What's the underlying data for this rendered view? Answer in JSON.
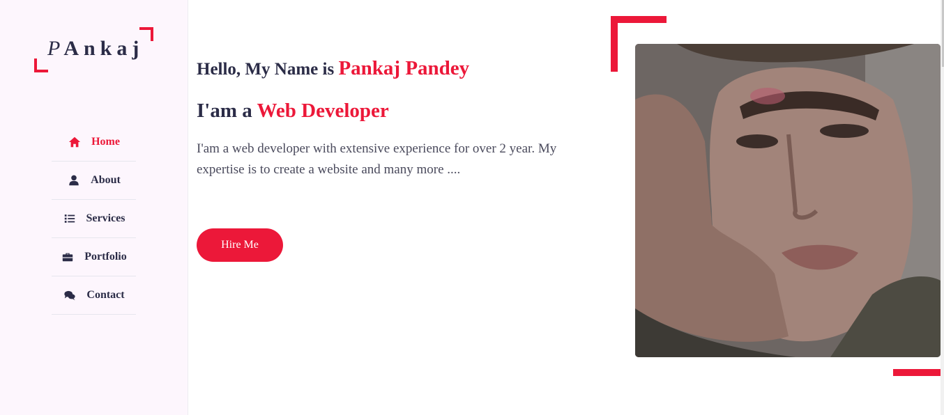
{
  "sidebar": {
    "logo": {
      "first_letter": "P",
      "rest": "Ankaj"
    },
    "items": [
      {
        "label": "Home",
        "icon": "home-icon",
        "active": true
      },
      {
        "label": "About",
        "icon": "user-icon",
        "active": false
      },
      {
        "label": "Services",
        "icon": "list-icon",
        "active": false
      },
      {
        "label": "Portfolio",
        "icon": "briefcase-icon",
        "active": false
      },
      {
        "label": "Contact",
        "icon": "comments-icon",
        "active": false
      }
    ]
  },
  "home": {
    "hello_prefix": "Hello, My Name is ",
    "name": "Pankaj Pandey",
    "role_prefix": "I'am a ",
    "role": "Web Developer",
    "description": "I'am a web developer with extensive experience for over 2 year. My expertise is to create a website and many more ....",
    "hire_button": "Hire Me"
  },
  "colors": {
    "accent": "#ec1839",
    "text_dark": "#2b2c47",
    "sidebar_bg": "#fdf6fd"
  }
}
